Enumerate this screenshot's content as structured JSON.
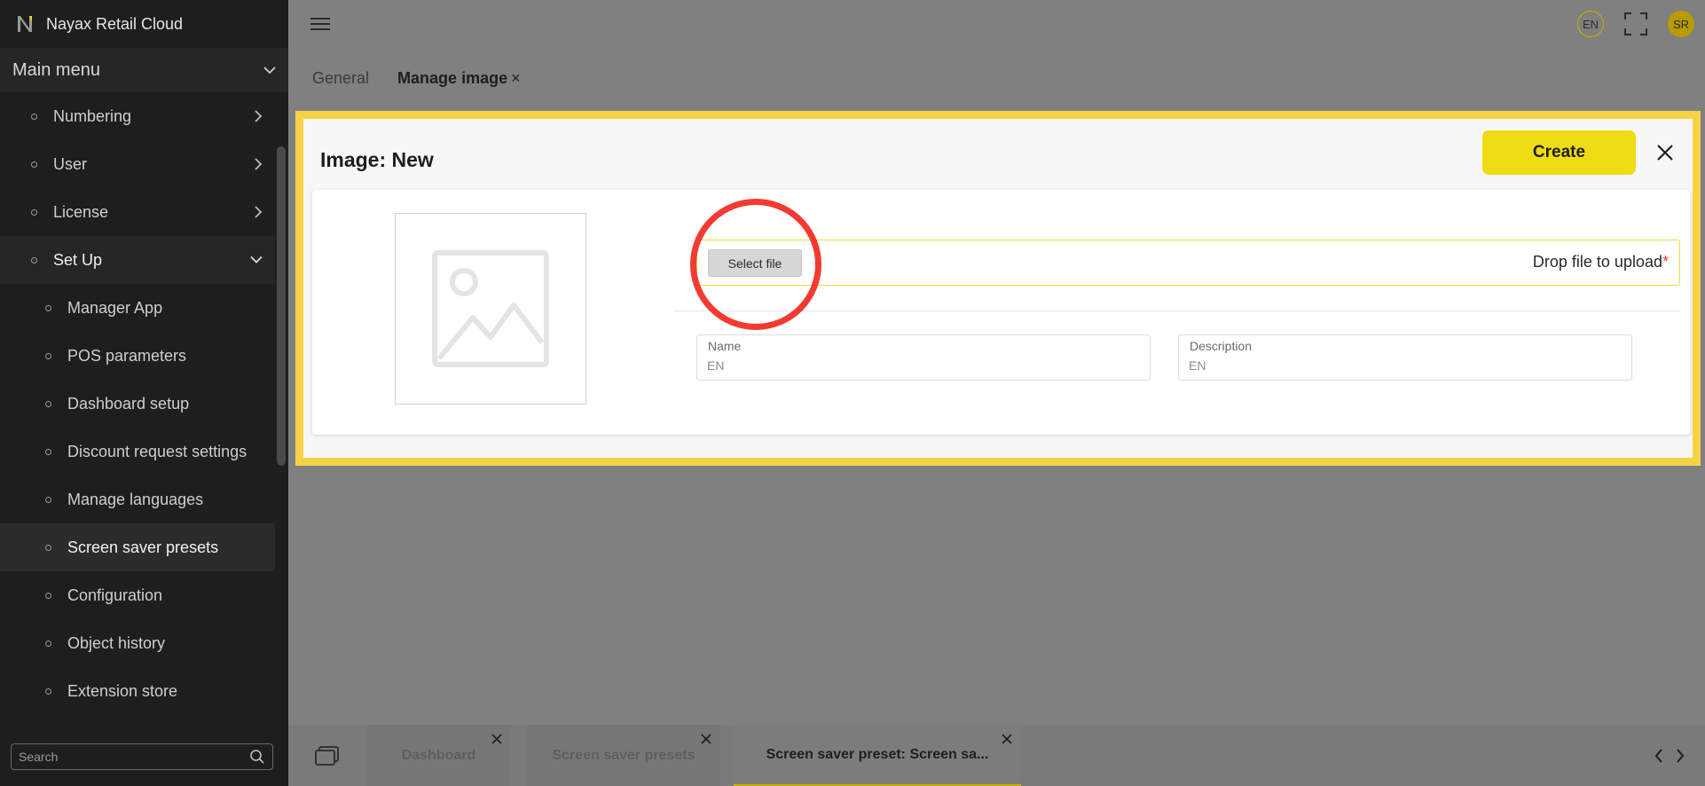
{
  "app": {
    "title": "Nayax Retail Cloud"
  },
  "sidebar": {
    "main_menu_label": "Main menu",
    "items": [
      {
        "label": "Numbering",
        "level": 1
      },
      {
        "label": "User",
        "level": 1
      },
      {
        "label": "License",
        "level": 1
      },
      {
        "label": "Set Up",
        "level": 1,
        "expanded": true
      },
      {
        "label": "Manager App",
        "level": 2
      },
      {
        "label": "POS parameters",
        "level": 2
      },
      {
        "label": "Dashboard setup",
        "level": 2
      },
      {
        "label": "Discount request settings",
        "level": 2
      },
      {
        "label": "Manage languages",
        "level": 2
      },
      {
        "label": "Screen saver presets",
        "level": 2,
        "active": true
      },
      {
        "label": "Configuration",
        "level": 2
      },
      {
        "label": "Object history",
        "level": 2
      },
      {
        "label": "Extension store",
        "level": 2
      }
    ],
    "search_placeholder": "Search"
  },
  "topbar": {
    "language_badge": "EN",
    "avatar_initials": "SR",
    "icons": [
      "hamburger-icon",
      "fullscreen-icon"
    ]
  },
  "page_tabs": [
    {
      "label": "General",
      "active": false
    },
    {
      "label": "Manage image",
      "active": true,
      "close": "×"
    }
  ],
  "modal": {
    "title": "Image: New",
    "create_label": "Create",
    "select_file_label": "Select file",
    "drop_label": "Drop file to upload",
    "required_mark": "*",
    "name_label": "Name",
    "name_placeholder": "EN",
    "description_label": "Description",
    "description_placeholder": "EN"
  },
  "bottom_tabs": [
    {
      "label": "Dashboard",
      "active": false
    },
    {
      "label": "Screen saver presets",
      "active": false
    },
    {
      "label": "Screen saver preset: Screen sa...",
      "active": true
    }
  ],
  "colors": {
    "accent": "#f0dc15",
    "frame": "#f7d247",
    "highlight": "#f23a30",
    "sidebar_bg": "#1e1e1e"
  }
}
